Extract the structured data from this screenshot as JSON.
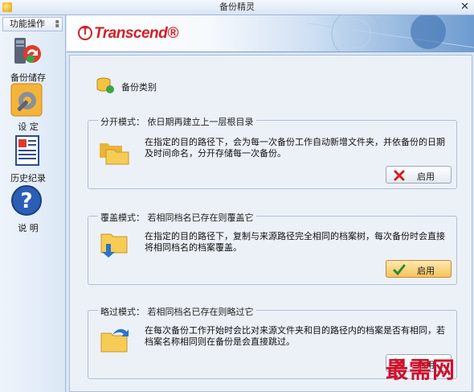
{
  "window": {
    "title": "备份精灵"
  },
  "sidebar": {
    "header": "功能操作",
    "items": [
      {
        "label": "备份储存",
        "icon": "backup-icon"
      },
      {
        "label": "设  定",
        "icon": "settings-icon"
      },
      {
        "label": "历史纪录",
        "icon": "history-icon"
      },
      {
        "label": "说  明",
        "icon": "help-icon"
      }
    ]
  },
  "banner": {
    "brand": "Transcend"
  },
  "main": {
    "section_title": "备份类别",
    "groups": [
      {
        "legend": "分开模式：  依日期再建立上一层根目录",
        "description": "在指定的目的路径下，会为每一次备份工作自动新增文件夹，并依备份的日期及时间命名，分开存储每一次备份。",
        "button_label": "启用",
        "button_state": "inactive"
      },
      {
        "legend": "覆盖模式：  若相同档名已存在则覆盖它",
        "description": "在指定的目的路径下，复制与来源路径完全相同的档案树，每次备份时会直接将相同档名的档案覆盖。",
        "button_label": "启用",
        "button_state": "active"
      },
      {
        "legend": "略过模式：  若相同档名已存在则略过它",
        "description": "在每次备份工作开始时会比对来源文件夹和目的路径内的档案是否有相同，若档案名称相同则在备份是会直接跳过。",
        "button_label": "启用",
        "button_state": "inactive"
      }
    ]
  },
  "watermark": "最需网",
  "colors": {
    "accent": "#d41f27",
    "active_button": "#f6c35e",
    "panel": "#ecf1f8"
  }
}
